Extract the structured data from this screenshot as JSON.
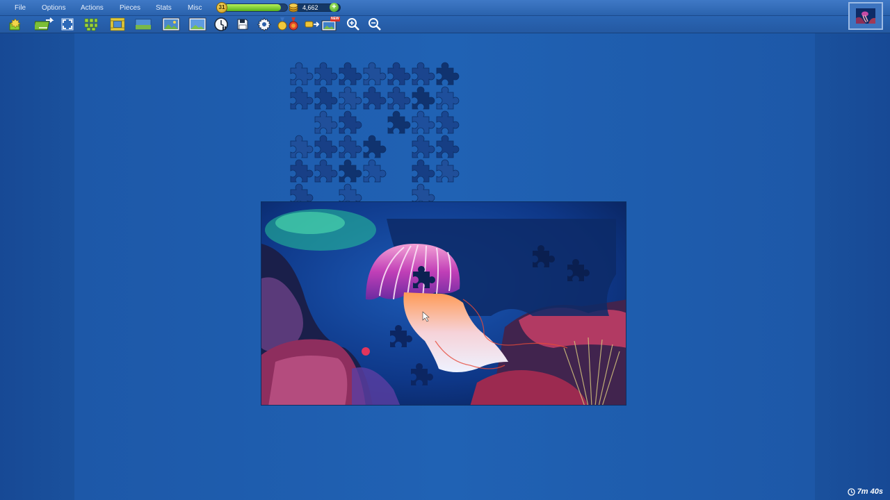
{
  "menu": {
    "items": [
      {
        "key": "file",
        "label": "File"
      },
      {
        "key": "options",
        "label": "Options"
      },
      {
        "key": "actions",
        "label": "Actions"
      },
      {
        "key": "pieces",
        "label": "Pieces"
      },
      {
        "key": "stats",
        "label": "Stats"
      },
      {
        "key": "misc",
        "label": "Misc"
      }
    ]
  },
  "status": {
    "level": "31",
    "level_progress": 0.9,
    "coins": "4,662",
    "add_coins_glyph": "+"
  },
  "toolbar": {
    "new_badge": "NEW",
    "icons": [
      "new-puzzle-icon",
      "shuffle-pieces-icon",
      "fullscreen-icon",
      "scatter-pieces-icon",
      "edge-pieces-icon",
      "background-icon",
      "show-image-icon",
      "ghost-image-icon",
      "timer-pause-icon",
      "save-icon",
      "settings-icon",
      "awards-icon",
      "puzzle-key-icon",
      "new-gallery-icon",
      "zoom-in-icon",
      "zoom-out-icon"
    ]
  },
  "timer": {
    "value": "7m 40s",
    "icon": "clock-icon"
  },
  "colors": {
    "board": "#2062b4",
    "menubar": "#2a62ad",
    "level_fill": "#57b21c",
    "accent_gold": "#e8b82c"
  }
}
